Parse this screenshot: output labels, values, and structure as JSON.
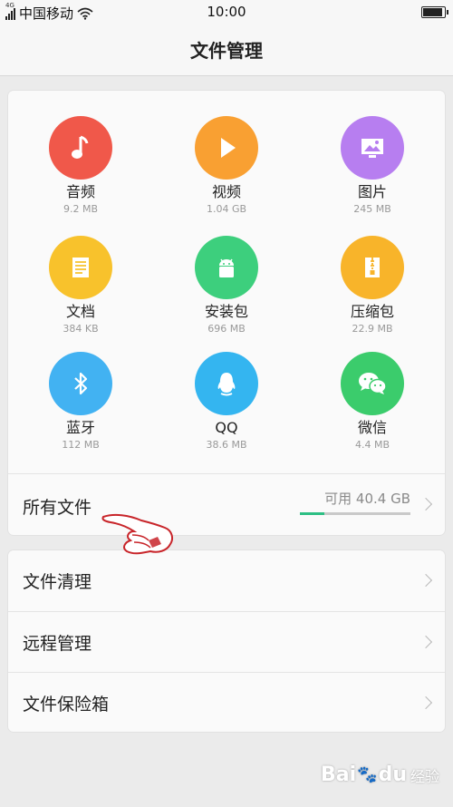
{
  "status_bar": {
    "network_type": "4G",
    "carrier": "中国移动",
    "time": "10:00",
    "battery_level": 0.9
  },
  "header": {
    "title": "文件管理"
  },
  "categories": [
    {
      "name": "音频",
      "size": "9.2 MB",
      "icon": "music-note-icon",
      "color": "#f0584a"
    },
    {
      "name": "视频",
      "size": "1.04 GB",
      "icon": "play-icon",
      "color": "#f9a032"
    },
    {
      "name": "图片",
      "size": "245 MB",
      "icon": "picture-icon",
      "color": "#b77ef0"
    },
    {
      "name": "文档",
      "size": "384 KB",
      "icon": "document-icon",
      "color": "#f8c22c"
    },
    {
      "name": "安装包",
      "size": "696 MB",
      "icon": "android-icon",
      "color": "#3dcf7d"
    },
    {
      "name": "压缩包",
      "size": "22.9 MB",
      "icon": "archive-icon",
      "color": "#f8b42a"
    },
    {
      "name": "蓝牙",
      "size": "112 MB",
      "icon": "bluetooth-icon",
      "color": "#42b2f2"
    },
    {
      "name": "QQ",
      "size": "38.6 MB",
      "icon": "qq-penguin-icon",
      "color": "#34b5f0"
    },
    {
      "name": "微信",
      "size": "4.4 MB",
      "icon": "wechat-icon",
      "color": "#3bcc6c"
    }
  ],
  "all_files": {
    "label": "所有文件",
    "available": "可用 40.4 GB",
    "used_fraction": 0.22
  },
  "menu": [
    {
      "label": "文件清理"
    },
    {
      "label": "远程管理"
    },
    {
      "label": "文件保险箱"
    }
  ],
  "watermark": {
    "brand_a": "Bai",
    "brand_b": "du",
    "sub": "经验"
  },
  "colors": {
    "accent": "#2dbf84",
    "background": "#ebebeb"
  }
}
